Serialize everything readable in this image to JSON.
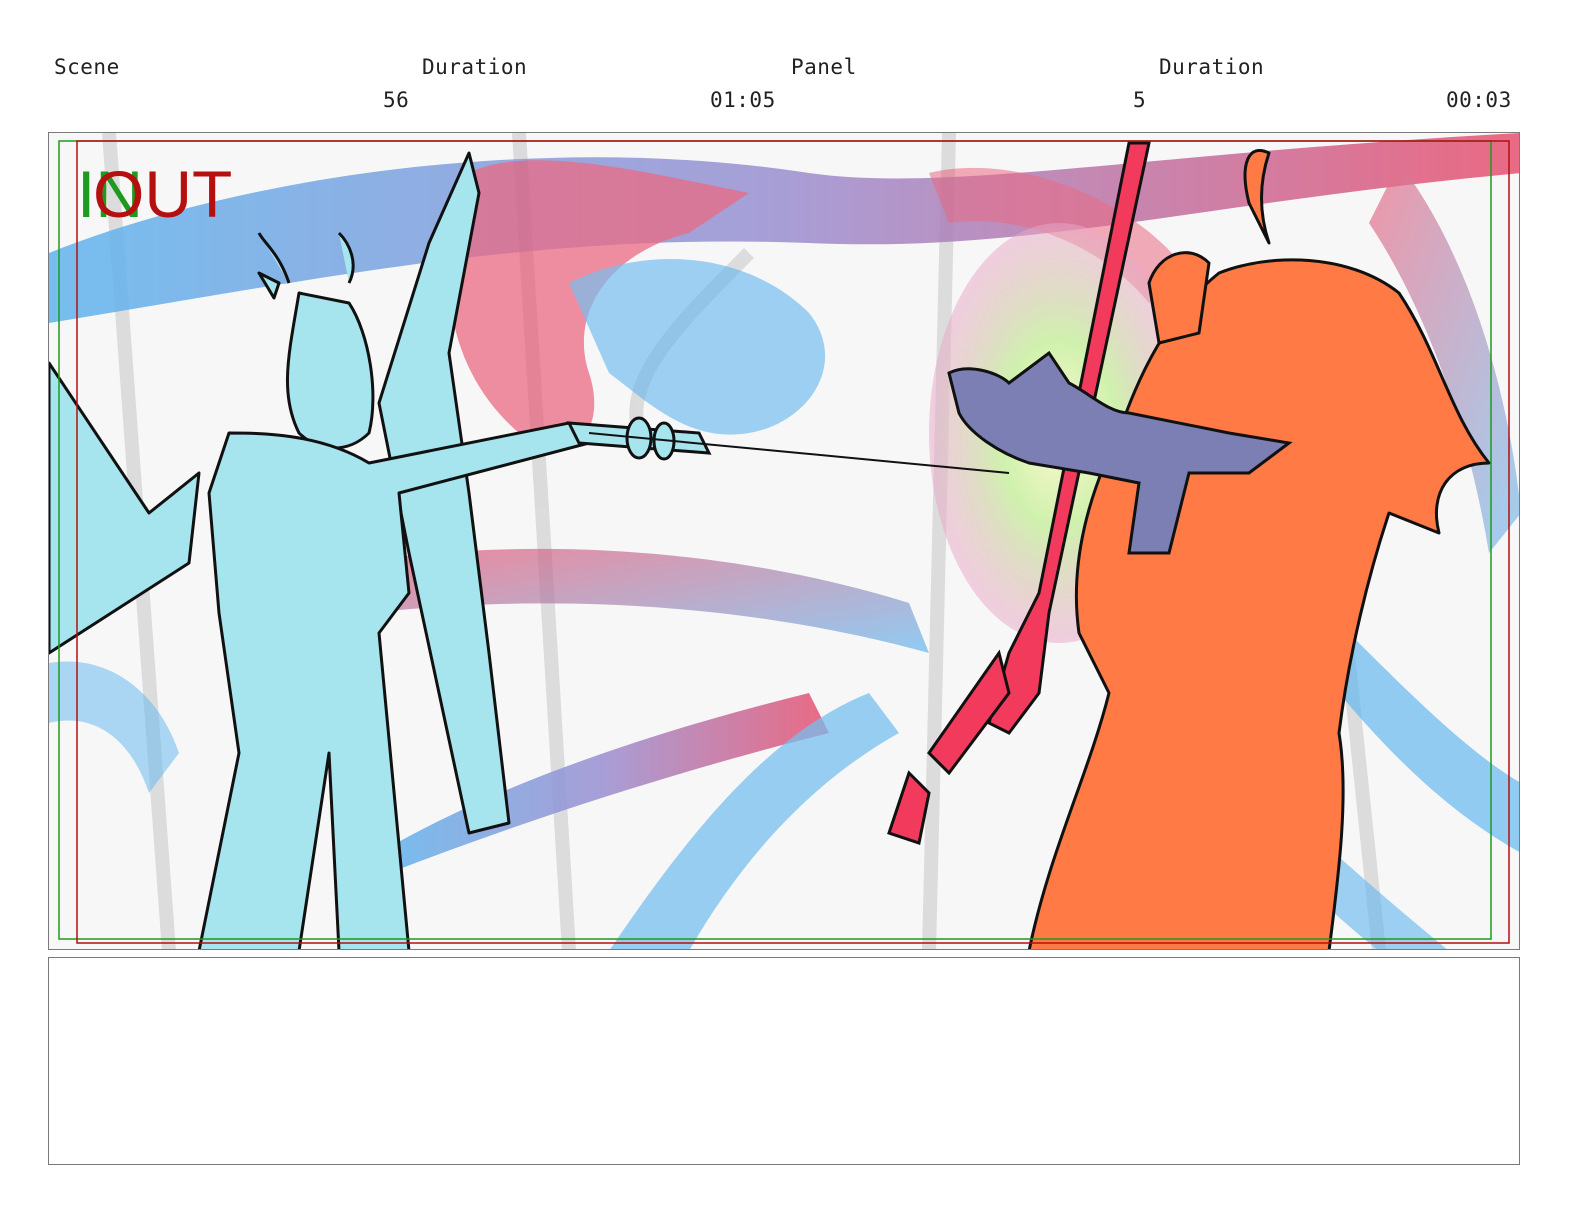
{
  "header": {
    "scene_label": "Scene",
    "scene_duration_label": "Duration",
    "panel_label": "Panel",
    "panel_duration_label": "Duration",
    "scene_number": "56",
    "scene_duration": "01:05",
    "panel_number": "5",
    "panel_duration": "00:03"
  },
  "frame": {
    "in_marker": "IN",
    "out_marker": "OUT",
    "colors": {
      "in_marker": "#1e9a1e",
      "out_marker": "#b50f0f",
      "cyan_character": "#a6e4ee",
      "orange_character": "#ff7a45",
      "bat": "#7b7fb4",
      "red_weapon": "#f23b5c",
      "sky_blue": "#5fb4ee",
      "pink": "#e8506e"
    }
  },
  "notes": {
    "text": ""
  }
}
